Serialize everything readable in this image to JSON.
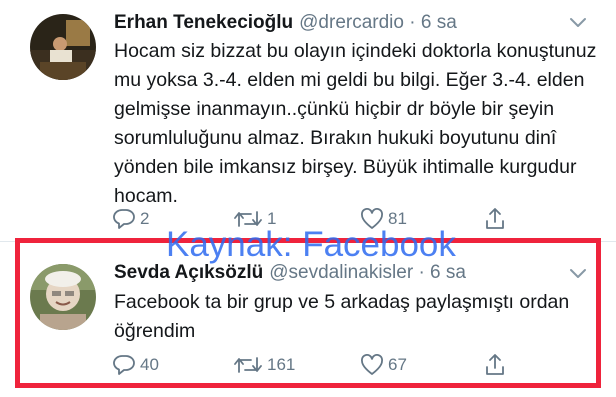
{
  "tweets": [
    {
      "author_name": "Erhan Tenekecioğlu",
      "handle": "@drercardio",
      "separator": "·",
      "time": "6 sa",
      "text": "Hocam siz bizzat bu olayın içindeki doktorla konuştunuz mu yoksa 3.-4.  elden mi geldi bu bilgi. Eğer 3.-4. elden gelmişse inanmayın..çünkü hiçbir dr böyle bir şeyin sorumluluğunu almaz. Bırakın hukuki boyutunu dinî yönden bile imkansız birşey. Büyük ihtimalle kurgudur hocam.",
      "reply_count": "2",
      "retweet_count": "1",
      "like_count": "81"
    },
    {
      "author_name": "Sevda Açıksözlü",
      "handle": "@sevdalinakisler",
      "separator": "·",
      "time": "6 sa",
      "text": "Facebook ta bir grup ve 5 arkadaş paylaşmıştı ordan öğrendim",
      "reply_count": "40",
      "retweet_count": "161",
      "like_count": "67"
    }
  ],
  "watermark": "Kaynak: Facebook",
  "colors": {
    "text_primary": "#14171a",
    "text_secondary": "#657786",
    "highlight_border": "#ef233c",
    "watermark": "#2d6bf0"
  },
  "icons": [
    "reply-icon",
    "retweet-icon",
    "like-icon",
    "share-icon",
    "chevron-down-icon"
  ]
}
